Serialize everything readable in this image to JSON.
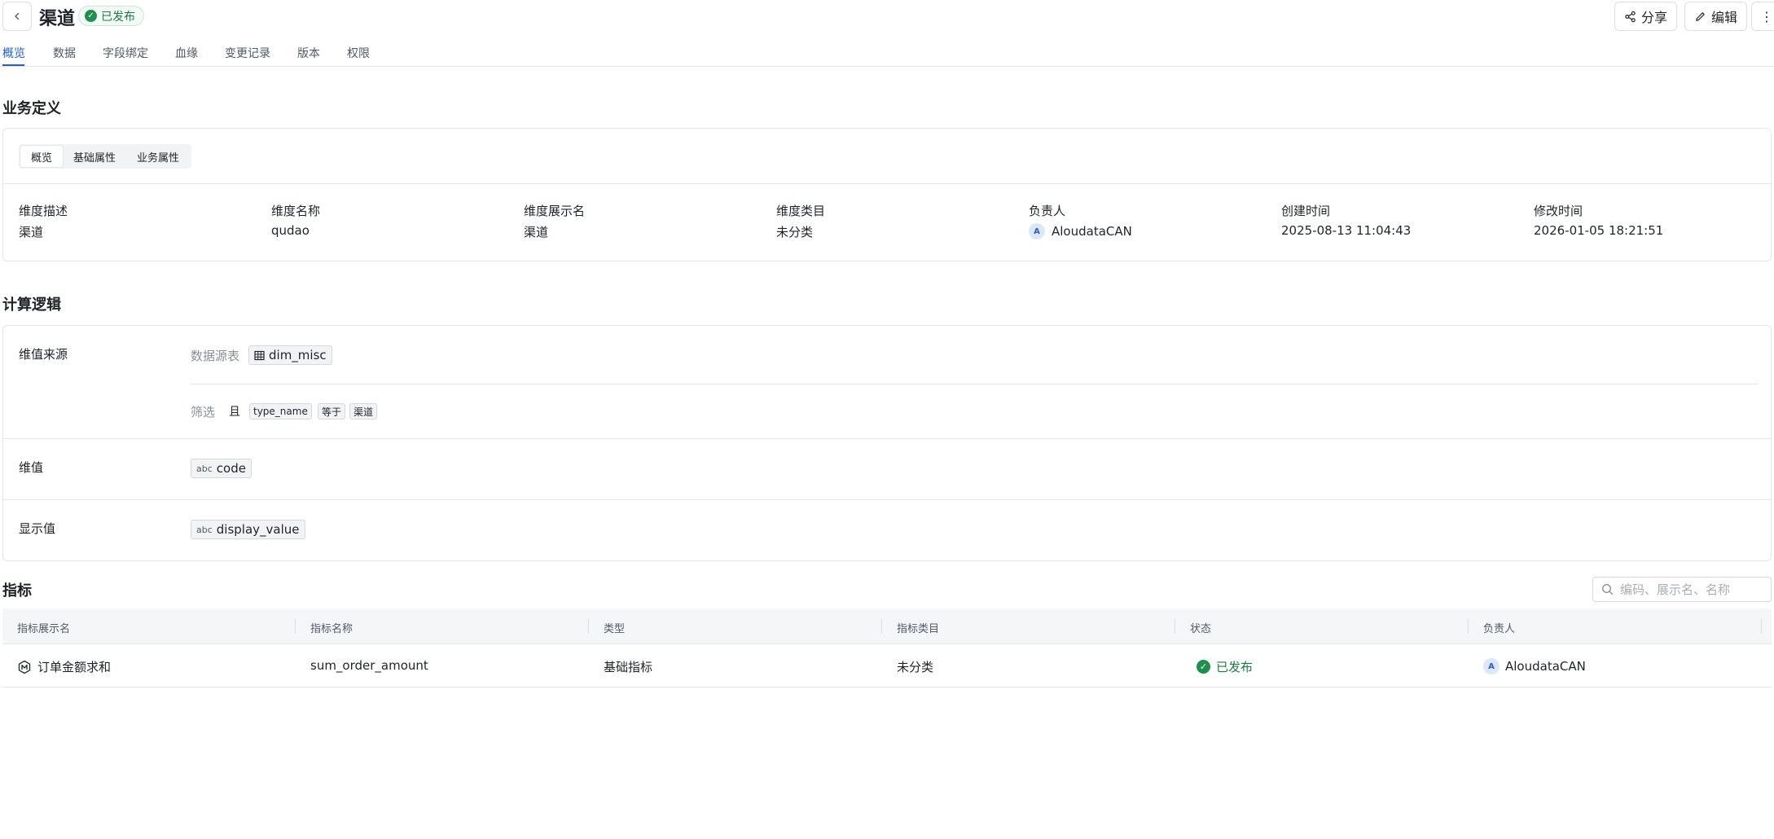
{
  "header": {
    "title": "渠道",
    "status": "已发布",
    "share_label": "分享",
    "edit_label": "编辑"
  },
  "tabs": [
    {
      "label": "概览"
    },
    {
      "label": "数据"
    },
    {
      "label": "字段绑定"
    },
    {
      "label": "血缘"
    },
    {
      "label": "变更记录"
    },
    {
      "label": "版本"
    },
    {
      "label": "权限"
    }
  ],
  "business": {
    "title": "业务定义",
    "subtabs": [
      "概览",
      "基础属性",
      "业务属性"
    ],
    "fields": [
      {
        "label": "维度描述",
        "value": "渠道"
      },
      {
        "label": "维度名称",
        "value": "qudao"
      },
      {
        "label": "维度展示名",
        "value": "渠道"
      },
      {
        "label": "维度类目",
        "value": "未分类"
      },
      {
        "label": "负责人",
        "value": "AloudataCAN",
        "avatar": "A"
      },
      {
        "label": "创建时间",
        "value": "2025-08-13 11:04:43"
      },
      {
        "label": "修改时间",
        "value": "2026-01-05 18:21:51"
      }
    ]
  },
  "logic": {
    "title": "计算逻辑",
    "source_label": "维值来源",
    "table_label": "数据源表",
    "table_name": "dim_misc",
    "filter_label": "筛选",
    "filter_conj": "且",
    "filter_field": "type_name",
    "filter_op": "等于",
    "filter_value": "渠道",
    "value_label": "维值",
    "value_type": "abc",
    "value_field": "code",
    "display_label": "显示值",
    "display_type": "abc",
    "display_field": "display_value"
  },
  "metrics": {
    "title": "指标",
    "search_placeholder": "编码、展示名、名称",
    "columns": [
      "指标展示名",
      "指标名称",
      "类型",
      "指标类目",
      "状态",
      "负责人"
    ],
    "rows": [
      {
        "display_name": "订单金额求和",
        "name": "sum_order_amount",
        "type": "基础指标",
        "category": "未分类",
        "status": "已发布",
        "owner": "AloudataCAN",
        "owner_avatar": "A"
      }
    ]
  },
  "colors": {
    "accent": "#1f5fd6",
    "success": "#1f8f4e"
  }
}
